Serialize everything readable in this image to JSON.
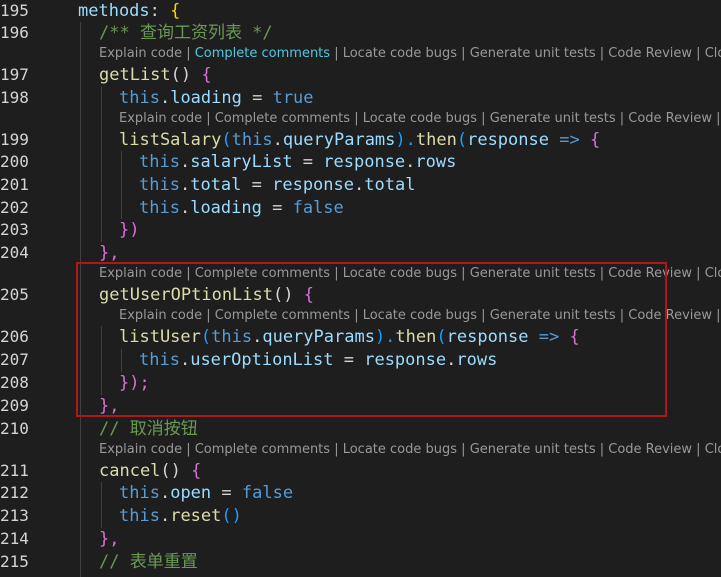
{
  "line_numbers": [
    "195",
    "196",
    "197",
    "198",
    "199",
    "200",
    "201",
    "202",
    "203",
    "204",
    "205",
    "206",
    "207",
    "208",
    "209",
    "210",
    "211",
    "212",
    "213",
    "214",
    "215"
  ],
  "lens": {
    "explain": "Explain code",
    "complete": "Complete comments",
    "locate": "Locate code bugs",
    "generate": "Generate unit tests",
    "review": "Code Review",
    "close": "Close",
    "close_short": "C",
    "sep": " | "
  },
  "code": {
    "l195": {
      "a": "methods",
      "b": ": ",
      "c": "{"
    },
    "l196": "/** 查询工资列表 */",
    "l197": {
      "fn": "getList",
      "p": "() ",
      "b": "{"
    },
    "l198": {
      "kw": "this",
      "p": ".",
      "prop": "loading",
      "eq": " = ",
      "v": "true"
    },
    "l199": {
      "fn": "listSalary",
      "p1": "(",
      "kw": "this",
      "p2": ".",
      "prop": "queryParams",
      "p3": ").",
      "fn2": "then",
      "p4": "(",
      "arg": "response",
      "arrow": " => ",
      "b": "{"
    },
    "l200": {
      "kw": "this",
      "p": ".",
      "prop": "salaryList",
      "eq": " = ",
      "prop2": "response",
      "p2": ".",
      "prop3": "rows"
    },
    "l201": {
      "kw": "this",
      "p": ".",
      "prop": "total",
      "eq": " = ",
      "prop2": "response",
      "p2": ".",
      "prop3": "total"
    },
    "l202": {
      "kw": "this",
      "p": ".",
      "prop": "loading",
      "eq": " = ",
      "v": "false"
    },
    "l203": "})",
    "l204": "},",
    "l205": {
      "fn": "getUserOPtionList",
      "p": "() ",
      "b": "{"
    },
    "l206": {
      "fn": "listUser",
      "p1": "(",
      "kw": "this",
      "p2": ".",
      "prop": "queryParams",
      "p3": ").",
      "fn2": "then",
      "p4": "(",
      "arg": "response",
      "arrow": " => ",
      "b": "{"
    },
    "l207": {
      "kw": "this",
      "p": ".",
      "prop": "userOptionList",
      "eq": " = ",
      "prop2": "response",
      "p2": ".",
      "prop3": "rows"
    },
    "l208": "});",
    "l209": "},",
    "l210": "// 取消按钮",
    "l211": {
      "fn": "cancel",
      "p": "() ",
      "b": "{"
    },
    "l212": {
      "kw": "this",
      "p": ".",
      "prop": "open",
      "eq": " = ",
      "v": "false"
    },
    "l213": {
      "kw": "this",
      "p": ".",
      "fn": "reset",
      "call": "()"
    },
    "l214": "},",
    "l215": "// 表单重置"
  },
  "colors": {
    "background": "#1e1e1e",
    "keyword": "#569cd6",
    "function": "#dcdcaa",
    "property": "#9cdcfe",
    "comment": "#6a9955",
    "lens_text": "#999999",
    "lens_highlight": "#4ec9e0",
    "highlight_box": "#b01818"
  }
}
